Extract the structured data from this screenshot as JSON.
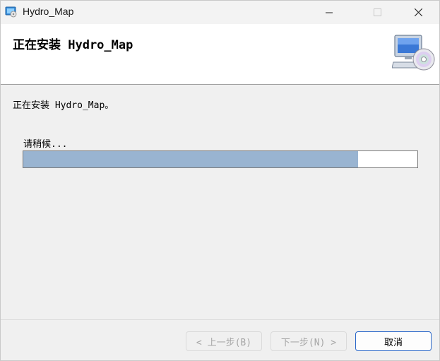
{
  "window": {
    "title": "Hydro_Map",
    "app_icon": "installer-app-icon",
    "controls": {
      "minimize": "minimize-icon",
      "maximize": "maximize-icon",
      "close": "close-icon"
    }
  },
  "banner": {
    "title": "正在安装 Hydro_Map",
    "icon": "computer-disc-icon"
  },
  "content": {
    "status": "正在安装 Hydro_Map。",
    "wait_label": "请稍候...",
    "progress_percent": 85
  },
  "footer": {
    "back_label": "< 上一步(B)",
    "next_label": "下一步(N) >",
    "cancel_label": "取消"
  },
  "colors": {
    "progress_fill": "#99b4d1",
    "cancel_border": "#2b68c9",
    "disabled_text": "#a6a6a6"
  }
}
